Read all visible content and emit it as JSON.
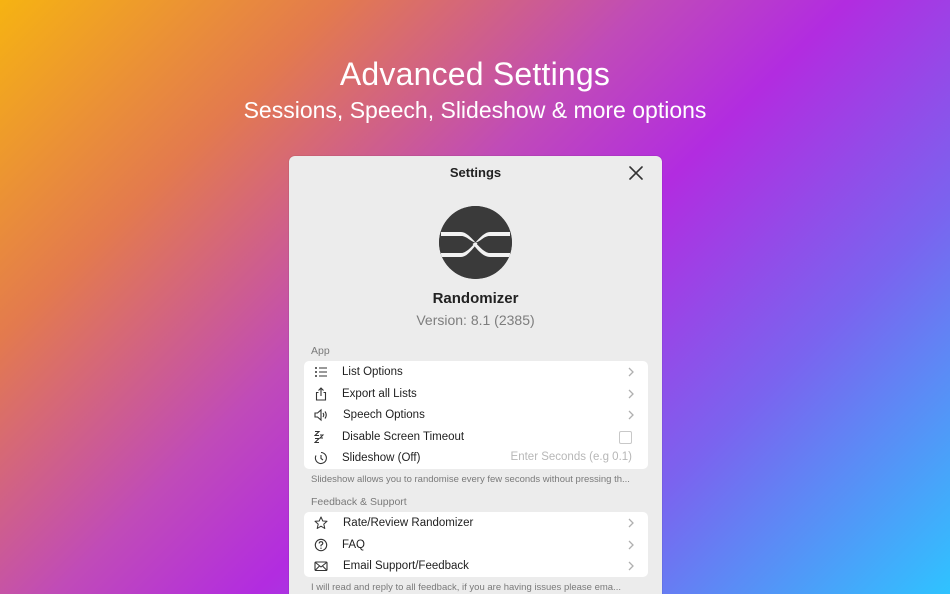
{
  "hero": {
    "title": "Advanced Settings",
    "subtitle": "Sessions, Speech, Slideshow & more options"
  },
  "window": {
    "title": "Settings",
    "close_icon": "close-icon"
  },
  "app": {
    "name": "Randomizer",
    "version": "Version: 8.1 (2385)",
    "logo_icon": "randomizer-logo"
  },
  "sections": {
    "app": {
      "header": "App",
      "items": [
        {
          "label": "List Options",
          "icon": "list-icon"
        },
        {
          "label": "Export all Lists",
          "icon": "share-icon"
        },
        {
          "label": "Speech Options",
          "icon": "speaker-icon"
        },
        {
          "label": "Disable Screen Timeout",
          "icon": "sleep-icon",
          "checked": false
        },
        {
          "label": "Slideshow (Off)",
          "icon": "timer-icon",
          "placeholder": "Enter Seconds (e.g 0.1)",
          "value": ""
        }
      ],
      "footnote": "Slideshow allows you to randomise every few seconds without pressing th..."
    },
    "feedback": {
      "header": "Feedback & Support",
      "items": [
        {
          "label": "Rate/Review Randomizer",
          "icon": "star-icon"
        },
        {
          "label": "FAQ",
          "icon": "question-icon"
        },
        {
          "label": "Email Support/Feedback",
          "icon": "envelope-icon"
        }
      ],
      "footnote": "I will read and reply to all feedback, if you are having issues please ema..."
    }
  },
  "colors": {
    "window_bg": "#ececec",
    "group_bg": "#ffffff",
    "secondary_text": "#7a7a7a"
  }
}
